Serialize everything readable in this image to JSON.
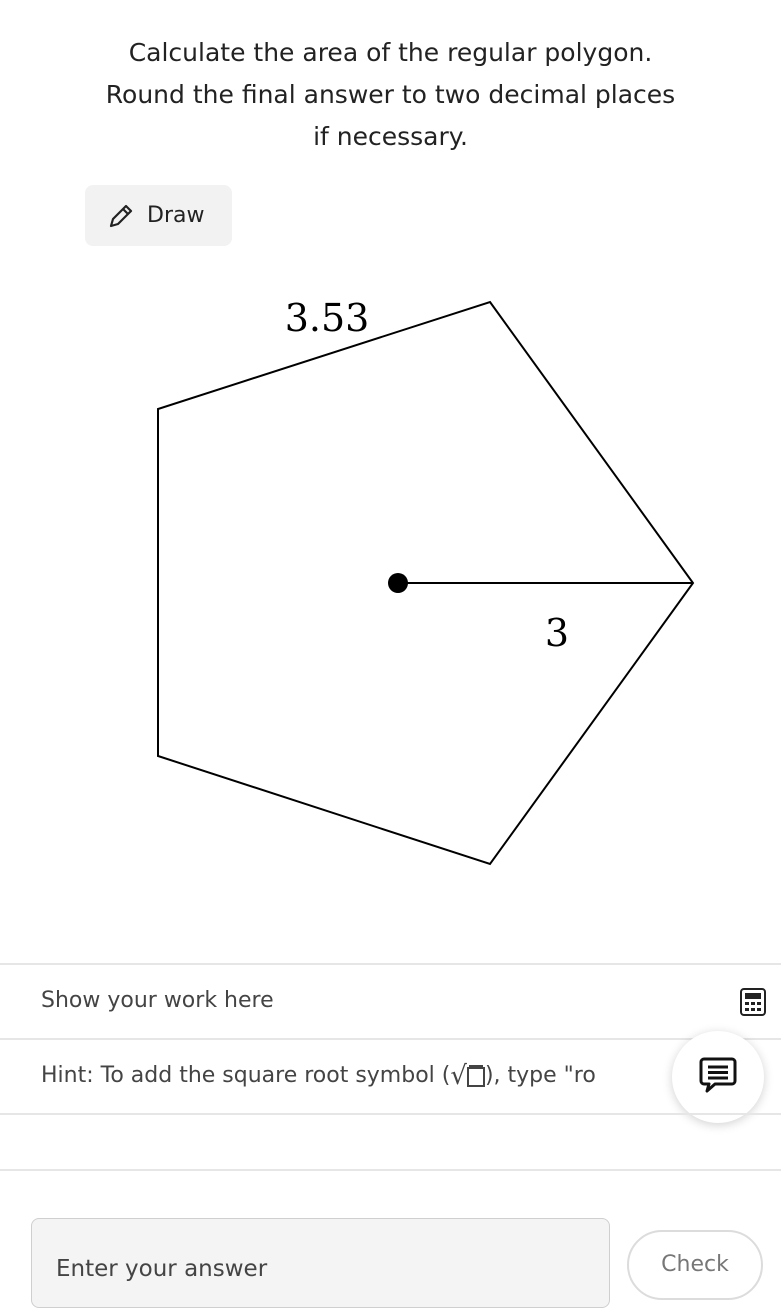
{
  "question": {
    "line1": "Calculate the area of the regular polygon.",
    "line2": "Round the final answer to two decimal places",
    "line3": "if necessary."
  },
  "toolbar": {
    "draw_label": "Draw",
    "draw_icon": "pencil-icon"
  },
  "figure": {
    "side_label": "3.53",
    "apothem_label": "3"
  },
  "work": {
    "label": "Show your work here",
    "calculator_icon": "calculator-icon"
  },
  "hint": {
    "prefix": "Hint: To add the square root symbol (",
    "suffix": "), type \"ro"
  },
  "chat": {
    "icon": "chat-bubble-icon"
  },
  "answer": {
    "placeholder": "Enter your answer",
    "value": "",
    "check_label": "Check"
  }
}
